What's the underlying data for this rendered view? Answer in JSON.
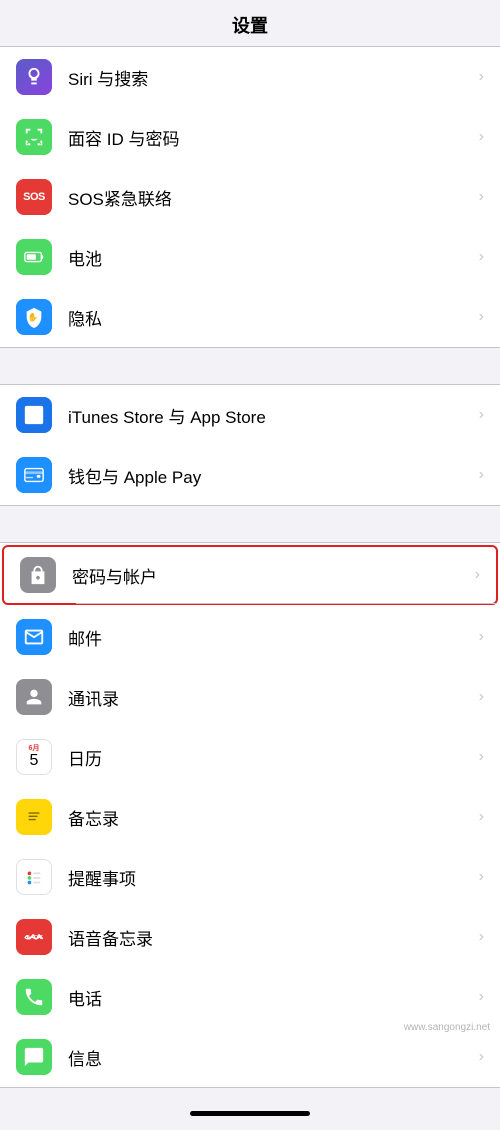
{
  "page": {
    "title": "设置"
  },
  "sections": [
    {
      "id": "section1",
      "items": [
        {
          "id": "siri",
          "label": "Siri 与搜索",
          "icon_type": "siri",
          "icon_text": "🎤"
        },
        {
          "id": "faceid",
          "label": "面容 ID 与密码",
          "icon_type": "faceid",
          "icon_text": "😊"
        },
        {
          "id": "sos",
          "label": "SOS紧急联络",
          "icon_type": "sos",
          "icon_text": "SOS"
        },
        {
          "id": "battery",
          "label": "电池",
          "icon_type": "battery",
          "icon_text": "🔋"
        },
        {
          "id": "privacy",
          "label": "隐私",
          "icon_type": "privacy",
          "icon_text": "✋"
        }
      ]
    },
    {
      "id": "section2",
      "items": [
        {
          "id": "itunes",
          "label": "iTunes Store 与 App Store",
          "icon_type": "itunes",
          "icon_text": "A"
        },
        {
          "id": "wallet",
          "label": "钱包与 Apple Pay",
          "icon_type": "wallet",
          "icon_text": "💳"
        }
      ]
    },
    {
      "id": "section3",
      "items": [
        {
          "id": "passwords",
          "label": "密码与帐户",
          "icon_type": "passwords",
          "icon_text": "🔑",
          "highlighted": true
        },
        {
          "id": "mail",
          "label": "邮件",
          "icon_type": "mail",
          "icon_text": "✉"
        },
        {
          "id": "contacts",
          "label": "通讯录",
          "icon_type": "contacts",
          "icon_text": "👤"
        },
        {
          "id": "calendar",
          "label": "日历",
          "icon_type": "calendar",
          "icon_text": ""
        },
        {
          "id": "notes",
          "label": "备忘录",
          "icon_type": "notes",
          "icon_text": "📝"
        },
        {
          "id": "reminders",
          "label": "提醒事项",
          "icon_type": "reminders",
          "icon_text": ""
        },
        {
          "id": "voice",
          "label": "语音备忘录",
          "icon_type": "voice",
          "icon_text": "🎙"
        },
        {
          "id": "phone",
          "label": "电话",
          "icon_type": "phone",
          "icon_text": "📞"
        },
        {
          "id": "messages",
          "label": "信息",
          "icon_type": "messages",
          "icon_text": "💬"
        }
      ]
    }
  ],
  "watermark": "www.sangongzi.net"
}
